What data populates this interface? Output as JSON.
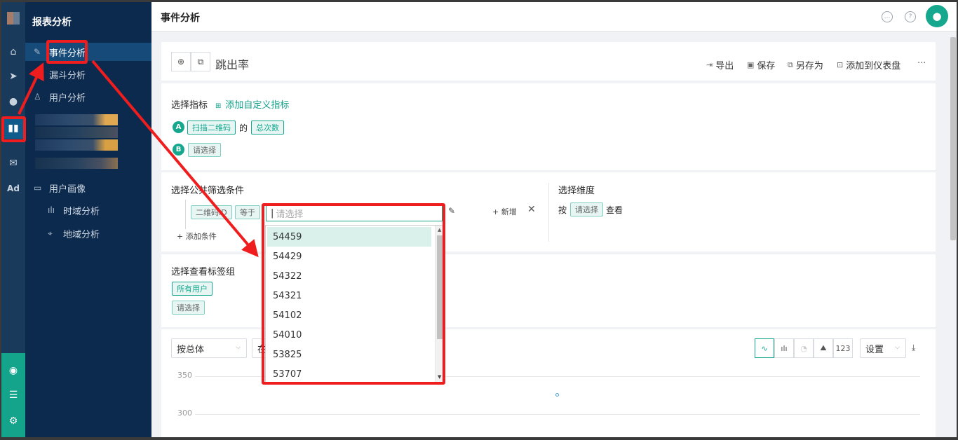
{
  "rail": {
    "ad_label": "Ad"
  },
  "sidebar": {
    "title": "报表分析",
    "items": [
      {
        "label": "事件分析",
        "icon": "edit-icon"
      },
      {
        "label": "漏斗分析",
        "icon": "funnel-icon"
      },
      {
        "label": "用户分析",
        "icon": "user-search-icon"
      },
      {
        "label": "用户画像",
        "icon": "folder-icon"
      },
      {
        "label": "时域分析",
        "icon": "bar-chart-icon"
      },
      {
        "label": "地域分析",
        "icon": "location-icon"
      }
    ]
  },
  "topbar": {
    "title": "事件分析"
  },
  "report": {
    "name": "跳出率",
    "actions": [
      "导出",
      "保存",
      "另存为",
      "添加到仪表盘"
    ],
    "more": "···"
  },
  "metrics": {
    "label": "选择指标",
    "add_custom": "添加自定义指标",
    "a_letter": "A",
    "a_event": "扫描二维码",
    "a_of": "的",
    "a_measure": "总次数",
    "b_letter": "B",
    "b_placeholder": "请选择"
  },
  "filters": {
    "label": "选择公共筛选条件",
    "field": "二维码ID",
    "op": "等于",
    "value_placeholder": "请选择",
    "add_new": "新增",
    "add_condition": "添加条件"
  },
  "dimension": {
    "label": "选择维度",
    "by": "按",
    "select": "请选择",
    "view": "查看"
  },
  "tags": {
    "label": "选择查看标签组",
    "all_users": "所有用户",
    "select": "请选择"
  },
  "chart_toolbar": {
    "group_by": "按总体",
    "second_select": "在",
    "count_button": "123",
    "settings": "设置"
  },
  "chart_data": {
    "type": "line",
    "y_ticks": [
      "350",
      "300"
    ],
    "x": [],
    "series": []
  },
  "dropdown": {
    "options": [
      "54459",
      "54429",
      "54322",
      "54321",
      "54102",
      "54010",
      "53825",
      "53707"
    ],
    "highlighted_index": 0
  },
  "colors": {
    "accent": "#15a88f",
    "sidebar": "#0c2a4e",
    "rail": "#1a3a5c",
    "annotation": "#ef1d1d"
  }
}
